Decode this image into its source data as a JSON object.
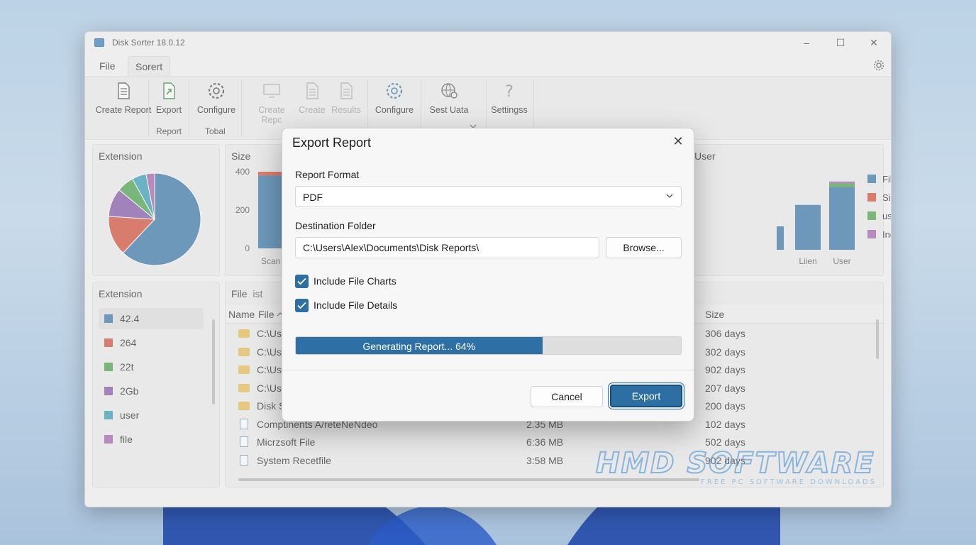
{
  "window": {
    "title": "Disk Sorter 18.0.12",
    "controls": {
      "minimize": "–",
      "maximize": "☐",
      "close": "✕"
    }
  },
  "menu": {
    "tabs": [
      "File",
      "Sorert"
    ],
    "active_tab": "Sorert"
  },
  "ribbon": {
    "buttons": [
      {
        "label": "Create Report",
        "icon": "report-icon",
        "enabled": true
      },
      {
        "label": "Export",
        "icon": "export-icon",
        "enabled": true
      },
      {
        "label": "Configure",
        "icon": "gear-icon",
        "enabled": true
      },
      {
        "label": "Create Repc",
        "icon": "monitor-icon",
        "enabled": false
      },
      {
        "label": "Create",
        "icon": "document-icon",
        "enabled": false
      },
      {
        "label": "Results",
        "icon": "document-icon",
        "enabled": false
      },
      {
        "label": "Configure",
        "icon": "gear-icon",
        "enabled": true
      },
      {
        "label": "Sest Uata",
        "icon": "globe-gear-icon",
        "enabled": true
      },
      {
        "label": "Settingss",
        "icon": "question-icon",
        "enabled": true
      }
    ],
    "group_labels": [
      "Report",
      "Tobal"
    ]
  },
  "panels": {
    "extension_chart": {
      "title": "Extension"
    },
    "size_chart": {
      "title": "Size"
    },
    "user_chart": {
      "title": "User"
    },
    "extension_list": {
      "title": "Extension",
      "items": [
        {
          "label": "42.4",
          "color": "#2e6fa3"
        },
        {
          "label": "264",
          "color": "#d2452f"
        },
        {
          "label": "22t",
          "color": "#3f9d3f"
        },
        {
          "label": "2Gb",
          "color": "#7f4ea3"
        },
        {
          "label": "user",
          "color": "#2a97b3"
        },
        {
          "label": "file",
          "color": "#a05aa8"
        }
      ]
    },
    "file_list": {
      "title": "File",
      "title_suffix": "ist",
      "columns": [
        "Name",
        "File",
        "Size"
      ],
      "rows": [
        {
          "name": "C:\\Use",
          "size": "",
          "count": "306 days",
          "type": "folder"
        },
        {
          "name": "C:\\Us",
          "size": "",
          "count": "302 days",
          "type": "folder"
        },
        {
          "name": "C:\\Us",
          "size": "",
          "count": "902 days",
          "type": "folder"
        },
        {
          "name": "C:\\Use",
          "size": "",
          "count": "207 days",
          "type": "folder"
        },
        {
          "name": "Disk S",
          "size": "",
          "count": "200 days",
          "type": "folder"
        },
        {
          "name": "Comptinents A/reteNeNdeo",
          "size": "2.35 MB",
          "count": "102 days",
          "type": "file"
        },
        {
          "name": "Micrzsoft File",
          "size": "6:36 MB",
          "count": "502 days",
          "type": "file"
        },
        {
          "name": "System Recetfile",
          "size": "3:58 MB",
          "count": "902 days",
          "type": "file"
        }
      ]
    }
  },
  "chart_data": [
    {
      "type": "pie",
      "title": "Extension",
      "slices": [
        {
          "value": 62,
          "color": "#2e6fa3"
        },
        {
          "value": 14,
          "color": "#d2452f"
        },
        {
          "value": 10,
          "color": "#7f4ea3"
        },
        {
          "value": 6,
          "color": "#3f9d3f"
        },
        {
          "value": 5,
          "color": "#2a97b3"
        },
        {
          "value": 3,
          "color": "#a05aa8"
        }
      ]
    },
    {
      "type": "bar",
      "title": "Size",
      "yticks": [
        "400",
        "200",
        "0"
      ],
      "ylim": [
        0,
        400
      ],
      "categories": [
        "Scan"
      ],
      "values": [
        380
      ],
      "cap_value": 20,
      "color": "#2e6fa3",
      "cap_color": "#d2452f"
    },
    {
      "type": "bar",
      "title": "User",
      "categories": [
        "",
        "Liien",
        "User"
      ],
      "values": [
        120,
        230,
        320
      ],
      "ylim": [
        0,
        400
      ],
      "stack_caps": [
        {
          "value": 20,
          "color": "#3f9d3f"
        },
        {
          "value": 10,
          "color": "#a05aa8"
        }
      ],
      "legend": [
        {
          "label": "File",
          "color": "#2e6fa3"
        },
        {
          "label": "Size",
          "color": "#d2452f"
        },
        {
          "label": "user",
          "color": "#3f9d3f"
        },
        {
          "label": "Include File Charts",
          "color": "#a05aa8"
        }
      ]
    }
  ],
  "dialog": {
    "title": "Export Report",
    "format_label": "Report Format",
    "format_value": "PDF",
    "folder_label": "Destination Folder",
    "folder_value": "C:\\Users\\Alex\\Documents\\Disk Reports\\",
    "browse_label": "Browse...",
    "check1_label": "Include File Charts",
    "check2_label": "Include File Details",
    "progress_text": "Generating Report... 64%",
    "progress_fraction": 0.64,
    "cancel_label": "Cancel",
    "export_label": "Export"
  },
  "watermark": {
    "text": "HMD SOFTWARE",
    "subtext": "FREE PC SOFTWARE DOWNLOADS"
  }
}
